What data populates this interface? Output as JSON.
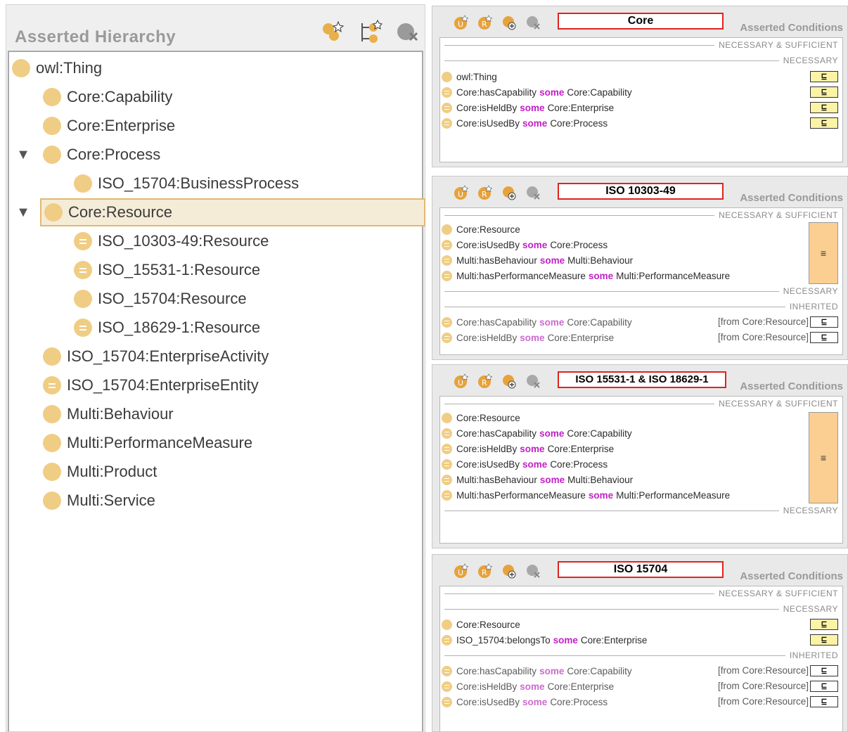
{
  "hierarchy": {
    "title": "Asserted Hierarchy",
    "toolbar": [
      "add-subclass-icon",
      "add-sibling-icon",
      "delete-class-icon"
    ],
    "nodes": [
      {
        "label": "owl:Thing",
        "icon": "class"
      },
      {
        "label": "Core:Capability",
        "icon": "class"
      },
      {
        "label": "Core:Enterprise",
        "icon": "class"
      },
      {
        "label": "Core:Process",
        "icon": "class",
        "expanded": true
      },
      {
        "label": "ISO_15704:BusinessProcess",
        "icon": "class"
      },
      {
        "label": "Core:Resource",
        "icon": "class",
        "expanded": true,
        "selected": true
      },
      {
        "label": "ISO_10303-49:Resource",
        "icon": "defined"
      },
      {
        "label": "ISO_15531-1:Resource",
        "icon": "defined"
      },
      {
        "label": "ISO_15704:Resource",
        "icon": "class"
      },
      {
        "label": "ISO_18629-1:Resource",
        "icon": "defined"
      },
      {
        "label": "ISO_15704:EnterpriseActivity",
        "icon": "class"
      },
      {
        "label": "ISO_15704:EnterpriseEntity",
        "icon": "defined"
      },
      {
        "label": "Multi:Behaviour",
        "icon": "class"
      },
      {
        "label": "Multi:PerformanceMeasure",
        "icon": "class"
      },
      {
        "label": "Multi:Product",
        "icon": "class"
      },
      {
        "label": "Multi:Service",
        "icon": "class"
      }
    ],
    "toggle_glyph": "▼"
  },
  "common": {
    "panel_title": "Asserted Conditions",
    "keyword": "some",
    "sep_nec_suf": "NECESSARY & SUFFICIENT",
    "sep_nec": "NECESSARY",
    "sep_inh": "INHERITED",
    "subclass_symbol": "⊑",
    "equiv_symbol": "≡",
    "from_resource": "[from Core:Resource]"
  },
  "panels": [
    {
      "label": "Core",
      "rows": [
        {
          "a": "owl:Thing"
        },
        {
          "a": "Core:hasCapability",
          "b": "Core:Capability"
        },
        {
          "a": "Core:isHeldBy",
          "b": "Core:Enterprise"
        },
        {
          "a": "Core:isUsedBy",
          "b": "Core:Process"
        }
      ]
    },
    {
      "label": "ISO 10303-49",
      "rows": [
        {
          "a": "Core:Resource"
        },
        {
          "a": "Core:isUsedBy",
          "b": "Core:Process"
        },
        {
          "a": "Multi:hasBehaviour",
          "b": "Multi:Behaviour"
        },
        {
          "a": "Multi:hasPerformanceMeasure",
          "b": "Multi:PerformanceMeasure"
        }
      ],
      "inherited": [
        {
          "a": "Core:hasCapability",
          "b": "Core:Capability"
        },
        {
          "a": "Core:isHeldBy",
          "b": "Core:Enterprise"
        }
      ]
    },
    {
      "label": "ISO 15531-1 & ISO 18629-1",
      "rows": [
        {
          "a": "Core:Resource"
        },
        {
          "a": "Core:hasCapability",
          "b": "Core:Capability"
        },
        {
          "a": "Core:isHeldBy",
          "b": "Core:Enterprise"
        },
        {
          "a": "Core:isUsedBy",
          "b": "Core:Process"
        },
        {
          "a": "Multi:hasBehaviour",
          "b": "Multi:Behaviour"
        },
        {
          "a": "Multi:hasPerformanceMeasure",
          "b": "Multi:PerformanceMeasure"
        }
      ]
    },
    {
      "label": "ISO 15704",
      "rows": [
        {
          "a": "Core:Resource"
        },
        {
          "a": "ISO_15704:belongsTo",
          "b": "Core:Enterprise"
        }
      ],
      "inherited": [
        {
          "a": "Core:hasCapability",
          "b": "Core:Capability"
        },
        {
          "a": "Core:isHeldBy",
          "b": "Core:Enterprise"
        },
        {
          "a": "Core:isUsedBy",
          "b": "Core:Process"
        }
      ]
    }
  ],
  "colors": {
    "class_icon": "#f0cd84",
    "keyword": "#c21fc7",
    "label_border": "#e0231d",
    "equiv_fill": "#fbcf92",
    "subclass_fill": "#fbf3a6"
  }
}
